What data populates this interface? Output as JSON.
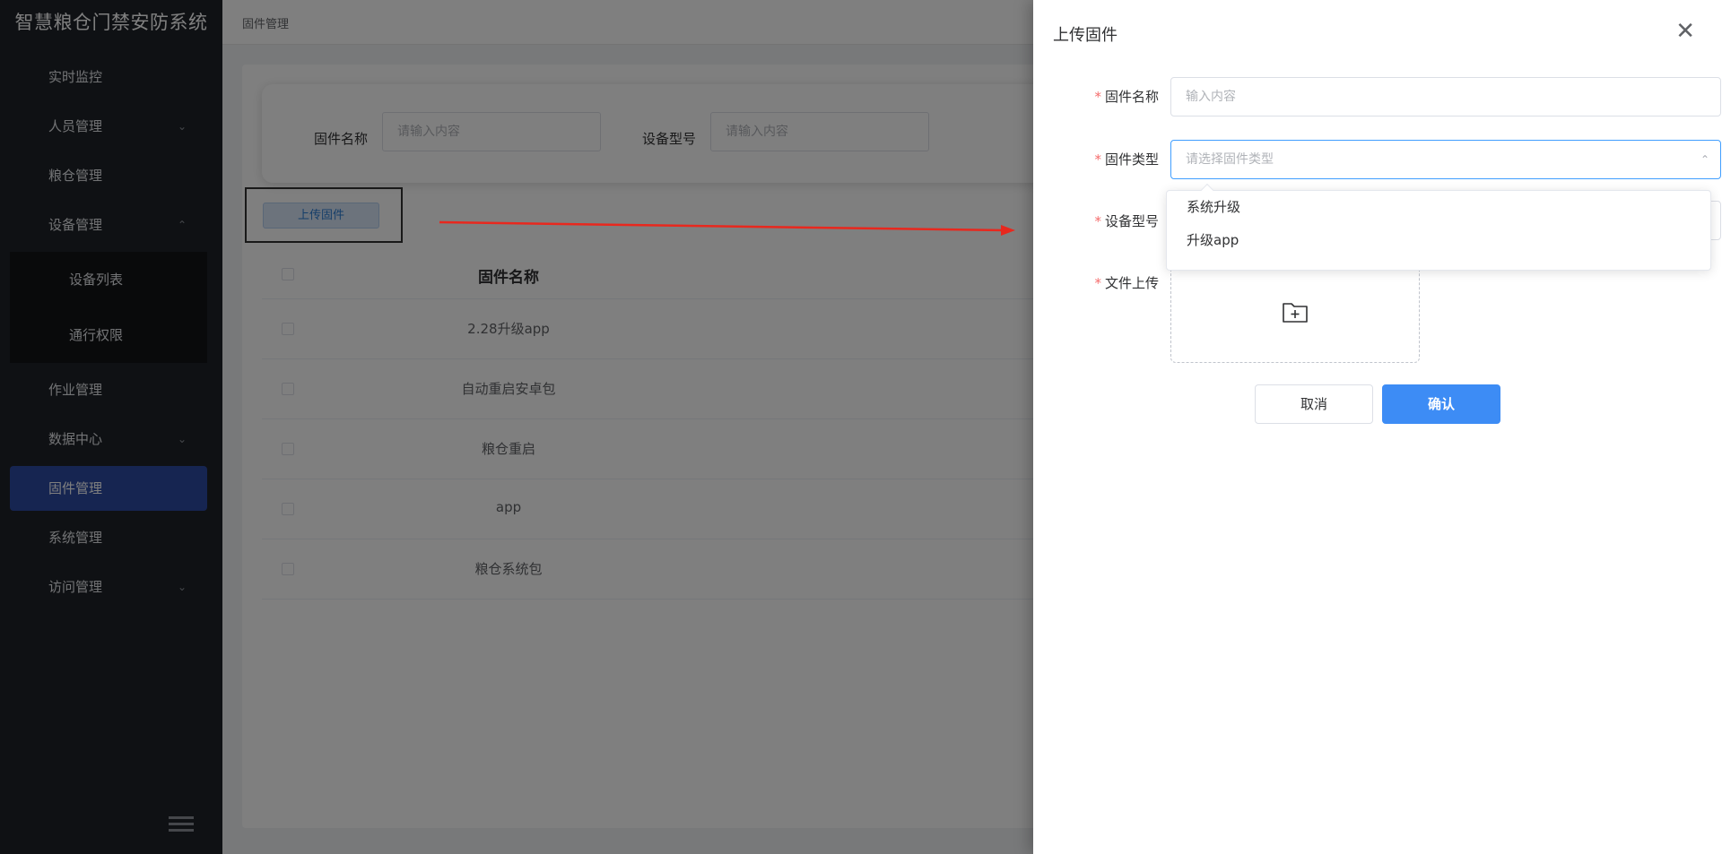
{
  "app_title": "智慧粮仓门禁安防系统",
  "sidebar": {
    "items": [
      {
        "label": "实时监控"
      },
      {
        "label": "人员管理"
      },
      {
        "label": "粮仓管理"
      },
      {
        "label": "设备管理"
      },
      {
        "label": "设备列表"
      },
      {
        "label": "通行权限"
      },
      {
        "label": "作业管理"
      },
      {
        "label": "数据中心"
      },
      {
        "label": "固件管理"
      },
      {
        "label": "系统管理"
      },
      {
        "label": "访问管理"
      }
    ]
  },
  "breadcrumb": "固件管理",
  "search": {
    "name_label": "固件名称",
    "name_placeholder": "请输入内容",
    "model_label": "设备型号",
    "model_placeholder": "请输入内容"
  },
  "upload_button": "上传固件",
  "table": {
    "header": "固件名称",
    "rows": [
      "2.28升级app",
      "自动重启安卓包",
      "粮仓重启",
      "app",
      "粮仓系统包"
    ]
  },
  "drawer": {
    "title": "上传固件",
    "close_icon": "close-icon",
    "fields": {
      "name_label": "固件名称",
      "name_placeholder": "输入内容",
      "type_label": "固件类型",
      "type_placeholder": "请选择固件类型",
      "model_label": "设备型号",
      "file_label": "文件上传"
    },
    "type_options": [
      "系统升级",
      "升级app"
    ],
    "cancel": "取消",
    "confirm": "确认"
  },
  "colors": {
    "sidebar_bg": "#1f2329",
    "active_item": "#2c4aa3",
    "primary": "#3d8cf5",
    "required": "#f56c6c",
    "arrow": "#e8281e"
  }
}
